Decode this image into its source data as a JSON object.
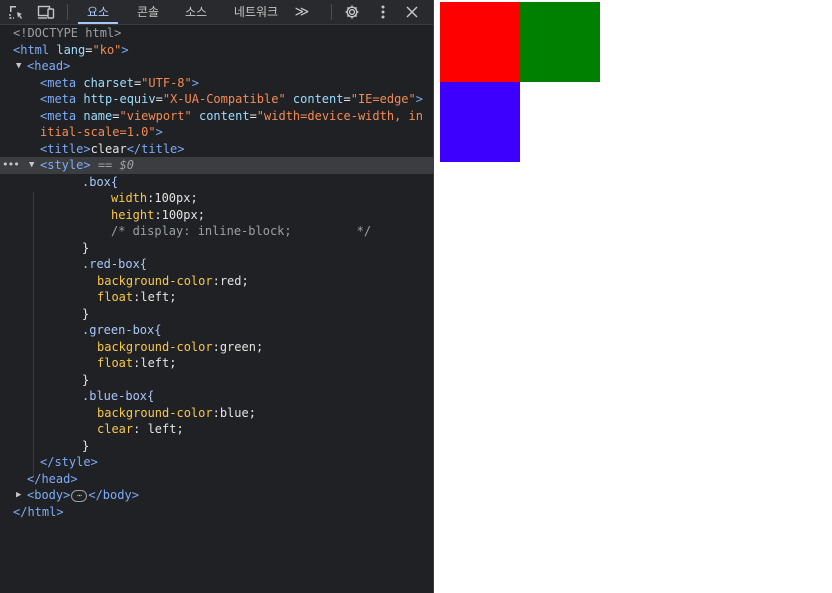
{
  "toolbar": {
    "icons": [
      "inspect-element-icon",
      "device-toolbar-icon"
    ],
    "tabs": [
      {
        "label": "요소",
        "active": true
      },
      {
        "label": "콘솔",
        "active": false
      },
      {
        "label": "소스",
        "active": false
      },
      {
        "label": "네트워크",
        "active": false
      }
    ],
    "more_tabs_label": "≫",
    "settings_icon": "gear-icon",
    "menu_icon": "kebab-menu-icon",
    "close_icon": "close-icon"
  },
  "code": {
    "doctype": "<!DOCTYPE html>",
    "html_open": "<html",
    "lang_attr": "lang",
    "lang_val": "\"ko\"",
    "html_close_bracket": ">",
    "head_open": "<head>",
    "meta1_open": "<meta",
    "meta1_attr": "charset",
    "meta1_val": "\"UTF-8\"",
    "meta2_open": "<meta",
    "meta2_attr1": "http-equiv",
    "meta2_val1": "\"X-UA-Compatible\"",
    "meta2_attr2": "content",
    "meta2_val2": "\"IE=edge\"",
    "meta3_open": "<meta",
    "meta3_attr1": "name",
    "meta3_val1": "\"viewport\"",
    "meta3_attr2": "content",
    "meta3_val2a": "\"width=device-width, in",
    "meta3_val2b": "itial-scale=1.0\"",
    "close_br": ">",
    "title_open": "<title>",
    "title_text": "clear",
    "title_close": "</title>",
    "style_open": "<style>",
    "style_eq": "== $0",
    "css": [
      {
        "type": "selector",
        "text": ".box{"
      },
      {
        "type": "decl",
        "prop": "width",
        "val": "100px;"
      },
      {
        "type": "decl",
        "prop": "height",
        "val": "100px;"
      },
      {
        "type": "comment",
        "text": "/* display: inline-block;         */"
      },
      {
        "type": "brace",
        "text": "}"
      },
      {
        "type": "selector",
        "text": ".red-box{"
      },
      {
        "type": "decl2",
        "prop": "background-color",
        "val": "red;"
      },
      {
        "type": "decl2",
        "prop": "float",
        "val": "left;"
      },
      {
        "type": "brace",
        "text": "}"
      },
      {
        "type": "selector",
        "text": ".green-box{"
      },
      {
        "type": "decl2",
        "prop": "background-color",
        "val": "green;"
      },
      {
        "type": "decl2",
        "prop": "float",
        "val": "left;"
      },
      {
        "type": "brace",
        "text": "}"
      },
      {
        "type": "selector",
        "text": ".blue-box{"
      },
      {
        "type": "decl2",
        "prop": "background-color",
        "val": "blue;"
      },
      {
        "type": "decl2",
        "prop": "clear",
        "val": " left;"
      },
      {
        "type": "brace",
        "text": "}"
      }
    ],
    "style_close": "</style>",
    "head_close": "</head>",
    "body_open": "<body>",
    "body_ellipsis": "⋯",
    "body_close": "</body>",
    "html_end": "</html>"
  },
  "colors": {
    "red_box": "#ff0000",
    "green_box": "#008000",
    "blue_box": "#3d00ff"
  }
}
